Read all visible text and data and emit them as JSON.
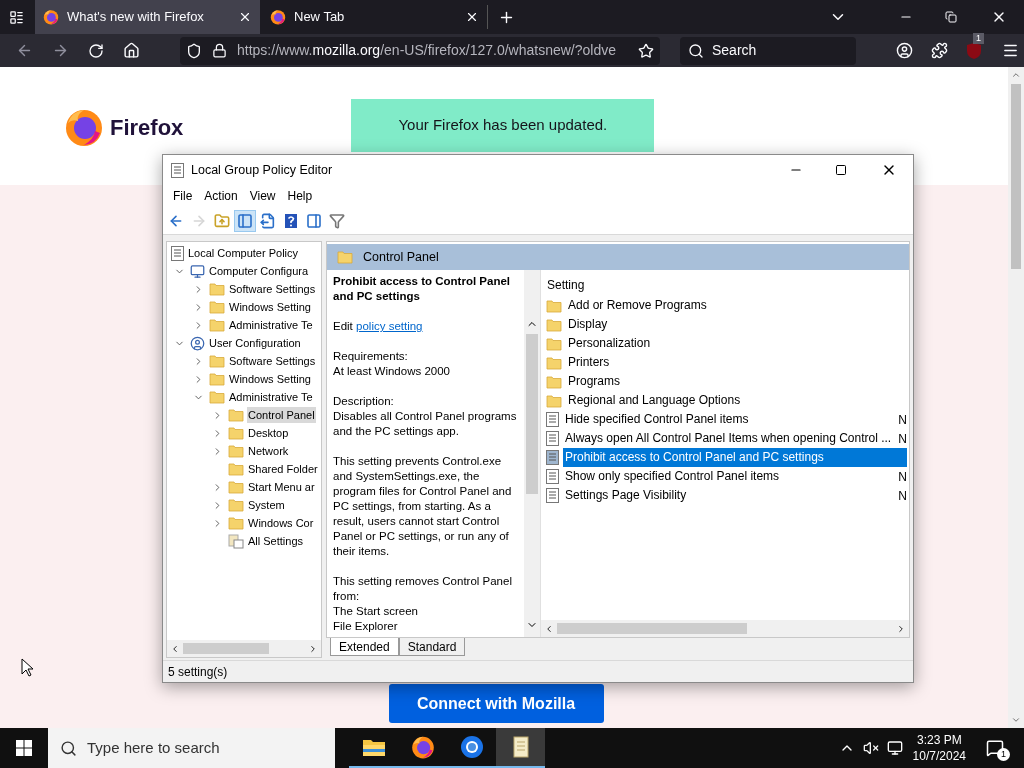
{
  "browser": {
    "tabs": [
      {
        "title": "What's new with Firefox",
        "selected": true
      },
      {
        "title": "New Tab",
        "selected": false
      }
    ],
    "url": {
      "scheme": "https://www.",
      "domain": "mozilla.org",
      "path": "/en-US/firefox/127.0/whatsnew/?oldve"
    },
    "search_placeholder": "Search",
    "extension_badge": "1"
  },
  "page": {
    "brand": "Firefox",
    "toast": "Your Firefox has been updated.",
    "cta": "Connect with Mozilla"
  },
  "window": {
    "title": "Local Group Policy Editor",
    "menu": [
      "File",
      "Action",
      "View",
      "Help"
    ],
    "toolbar": [
      {
        "kind": "back",
        "disabled": false,
        "pressed": false
      },
      {
        "kind": "forward",
        "disabled": true,
        "pressed": false
      },
      {
        "kind": "up",
        "disabled": false,
        "pressed": false
      },
      {
        "kind": "tree",
        "disabled": false,
        "pressed": true
      },
      {
        "kind": "export",
        "disabled": false,
        "pressed": false
      },
      {
        "kind": "help",
        "disabled": false,
        "pressed": false
      },
      {
        "kind": "pane",
        "disabled": false,
        "pressed": false
      },
      {
        "kind": "filter",
        "disabled": false,
        "pressed": false
      }
    ],
    "tree": [
      {
        "label": "Local Computer Policy",
        "kind": "policy",
        "selected": false,
        "children": [
          {
            "label": "Computer Configura",
            "kind": "computer",
            "expanded": true,
            "selected": false,
            "children": [
              {
                "label": "Software Settings",
                "kind": "folder",
                "expanded": false,
                "selected": false
              },
              {
                "label": "Windows Setting",
                "kind": "folder",
                "expanded": false,
                "selected": false
              },
              {
                "label": "Administrative Te",
                "kind": "folder",
                "expanded": false,
                "selected": false
              }
            ]
          },
          {
            "label": "User Configuration",
            "kind": "user",
            "expanded": true,
            "selected": false,
            "children": [
              {
                "label": "Software Settings",
                "kind": "folder",
                "expanded": false,
                "selected": false
              },
              {
                "label": "Windows Setting",
                "kind": "folder",
                "expanded": false,
                "selected": false
              },
              {
                "label": "Administrative Te",
                "kind": "folder",
                "expanded": true,
                "selected": false,
                "children": [
                  {
                    "label": "Control Panel",
                    "kind": "folder",
                    "expanded": false,
                    "selected": true
                  },
                  {
                    "label": "Desktop",
                    "kind": "folder",
                    "expanded": false,
                    "selected": false
                  },
                  {
                    "label": "Network",
                    "kind": "folder",
                    "expanded": false,
                    "selected": false
                  },
                  {
                    "label": "Shared Folder",
                    "kind": "folder",
                    "selected": false
                  },
                  {
                    "label": "Start Menu ar",
                    "kind": "folder",
                    "expanded": false,
                    "selected": false
                  },
                  {
                    "label": "System",
                    "kind": "folder",
                    "expanded": false,
                    "selected": false
                  },
                  {
                    "label": "Windows Cor",
                    "kind": "folder",
                    "expanded": false,
                    "selected": false
                  },
                  {
                    "label": "All Settings",
                    "kind": "settings",
                    "selected": false
                  }
                ]
              }
            ]
          }
        ]
      }
    ],
    "header": "Control Panel",
    "description": {
      "title": "Prohibit access to Control Panel and PC settings",
      "edit_label": "Edit",
      "edit_link": "policy setting",
      "paragraphs": [
        "Requirements:\nAt least Windows 2000",
        "Description:\nDisables all Control Panel programs and the PC settings app.",
        "This setting prevents Control.exe and SystemSettings.exe, the program files for Control Panel and PC settings, from starting. As a result, users cannot start Control Panel or PC settings, or run any of their items.",
        "This setting removes Control Panel from:\nThe Start screen\nFile Explorer"
      ]
    },
    "list": {
      "column": "Setting",
      "items": [
        {
          "name": "Add or Remove Programs",
          "kind": "folder",
          "selected": false
        },
        {
          "name": "Display",
          "kind": "folder",
          "selected": false
        },
        {
          "name": "Personalization",
          "kind": "folder",
          "selected": false
        },
        {
          "name": "Printers",
          "kind": "folder",
          "selected": false
        },
        {
          "name": "Programs",
          "kind": "folder",
          "selected": false
        },
        {
          "name": "Regional and Language Options",
          "kind": "folder",
          "selected": false
        },
        {
          "name": "Hide specified Control Panel items",
          "kind": "policy",
          "selected": false,
          "column_2": "N"
        },
        {
          "name": "Always open All Control Panel Items when opening Control ...",
          "kind": "policy",
          "selected": false,
          "column_2": "N"
        },
        {
          "name": "Prohibit access to Control Panel and PC settings",
          "kind": "policy",
          "selected": true
        },
        {
          "name": "Show only specified Control Panel items",
          "kind": "policy",
          "selected": false,
          "column_2": "N"
        },
        {
          "name": "Settings Page Visibility",
          "kind": "policy",
          "selected": false,
          "column_2": "N"
        }
      ]
    },
    "view_tabs": [
      {
        "label": "Extended",
        "selected": true
      },
      {
        "label": "Standard",
        "selected": false
      }
    ],
    "status": "5 setting(s)"
  },
  "taskbar": {
    "search_placeholder": "Type here to search",
    "apps": [
      {
        "kind": "explorer",
        "selected": false
      },
      {
        "kind": "firefox",
        "selected": false
      },
      {
        "kind": "chrome",
        "selected": false
      },
      {
        "kind": "notepad",
        "selected": true
      }
    ],
    "time": "3:23 PM",
    "date": "10/7/2024",
    "notification_count": "1"
  }
}
